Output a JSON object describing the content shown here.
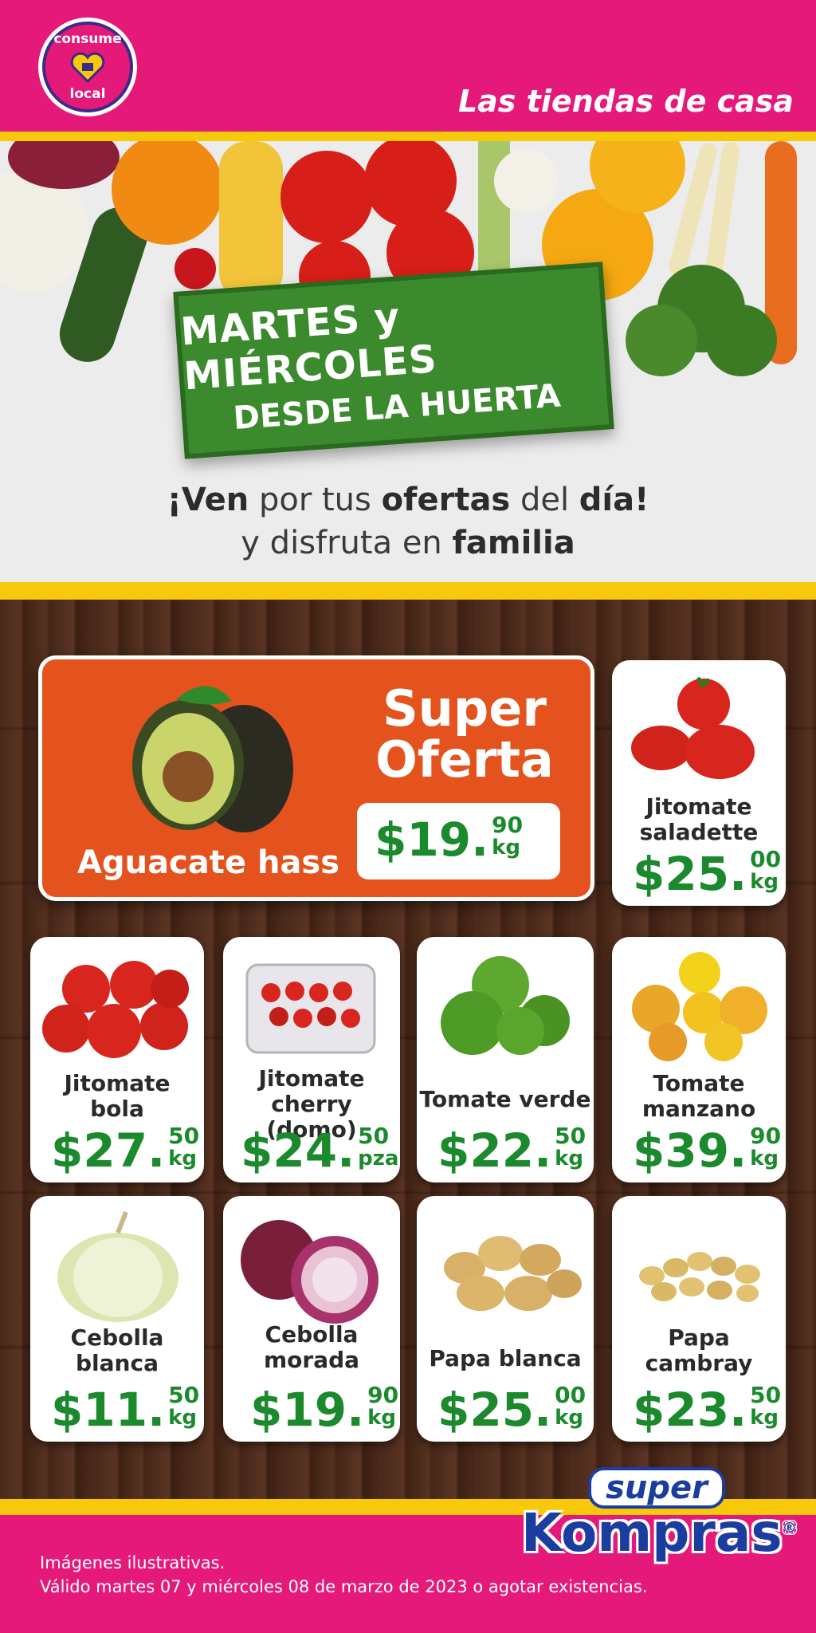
{
  "header": {
    "badge_top": "consume",
    "badge_bottom": "local",
    "tagline": "Las tiendas de casa"
  },
  "hero": {
    "sign_line1": "MARTES y MIÉRCOLES",
    "sign_line2": "DESDE LA HUERTA",
    "line1_parts": [
      "¡Ven",
      " por tus ",
      "ofertas",
      " del ",
      "día!"
    ],
    "line2_parts": [
      "y disfruta en ",
      "familia"
    ]
  },
  "super_offer": {
    "title_line1": "Super",
    "title_line2": "Oferta",
    "product": "Aguacate hass",
    "price_main": "$19.",
    "price_cents": "90",
    "price_unit": "kg"
  },
  "products": [
    {
      "name_lines": [
        "Jitomate",
        "saladette"
      ],
      "price_main": "$25.",
      "price_cents": "00",
      "price_unit": "kg"
    },
    {
      "name_lines": [
        "Jitomate",
        "bola"
      ],
      "price_main": "$27.",
      "price_cents": "50",
      "price_unit": "kg"
    },
    {
      "name_lines": [
        "Jitomate",
        "cherry (domo)"
      ],
      "price_main": "$24.",
      "price_cents": "50",
      "price_unit": "pza"
    },
    {
      "name_lines": [
        "Tomate verde",
        ""
      ],
      "price_main": "$22.",
      "price_cents": "50",
      "price_unit": "kg"
    },
    {
      "name_lines": [
        "Tomate",
        "manzano"
      ],
      "price_main": "$39.",
      "price_cents": "90",
      "price_unit": "kg"
    },
    {
      "name_lines": [
        "Cebolla",
        "blanca"
      ],
      "price_main": "$11.",
      "price_cents": "50",
      "price_unit": "kg"
    },
    {
      "name_lines": [
        "Cebolla",
        "morada"
      ],
      "price_main": "$19.",
      "price_cents": "90",
      "price_unit": "kg"
    },
    {
      "name_lines": [
        "Papa blanca",
        ""
      ],
      "price_main": "$25.",
      "price_cents": "00",
      "price_unit": "kg"
    },
    {
      "name_lines": [
        "Papa",
        "cambray"
      ],
      "price_main": "$23.",
      "price_cents": "50",
      "price_unit": "kg"
    }
  ],
  "logo": {
    "line1": "super",
    "line2": "Kompras",
    "mark": "®"
  },
  "footer": {
    "line1": "Imágenes ilustrativas.",
    "line2": "Válido martes 07 y miércoles 08 de marzo de 2023 o agotar existencias."
  },
  "colors": {
    "magenta": "#e5197a",
    "yellow": "#f7c90a",
    "green_price": "#1a8a2c",
    "orange_offer": "#e4531e",
    "brand_blue": "#1b3d9e"
  }
}
